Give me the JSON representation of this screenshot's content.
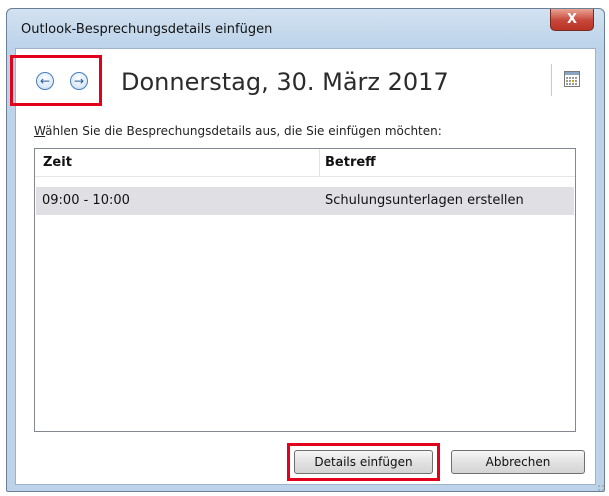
{
  "window": {
    "title": "Outlook-Besprechungsdetails einfügen",
    "close_label": "X"
  },
  "nav": {
    "prev_glyph": "←",
    "next_glyph": "→"
  },
  "header": {
    "date": "Donnerstag, 30. März 2017"
  },
  "prompt": {
    "accel": "W",
    "rest": "ählen Sie die Besprechungsdetails aus, die Sie einfügen möchten:"
  },
  "list": {
    "columns": [
      "Zeit",
      "Betreff"
    ],
    "rows": [
      {
        "time": "09:00 - 10:00",
        "subject": "Schulungsunterlagen erstellen"
      }
    ]
  },
  "buttons": {
    "insert_details": "Details einfügen",
    "cancel": "Abbrechen"
  },
  "colors": {
    "highlight": "#e3001b",
    "selected_row": "#dfdfe4",
    "close_button": "#c7463a"
  }
}
